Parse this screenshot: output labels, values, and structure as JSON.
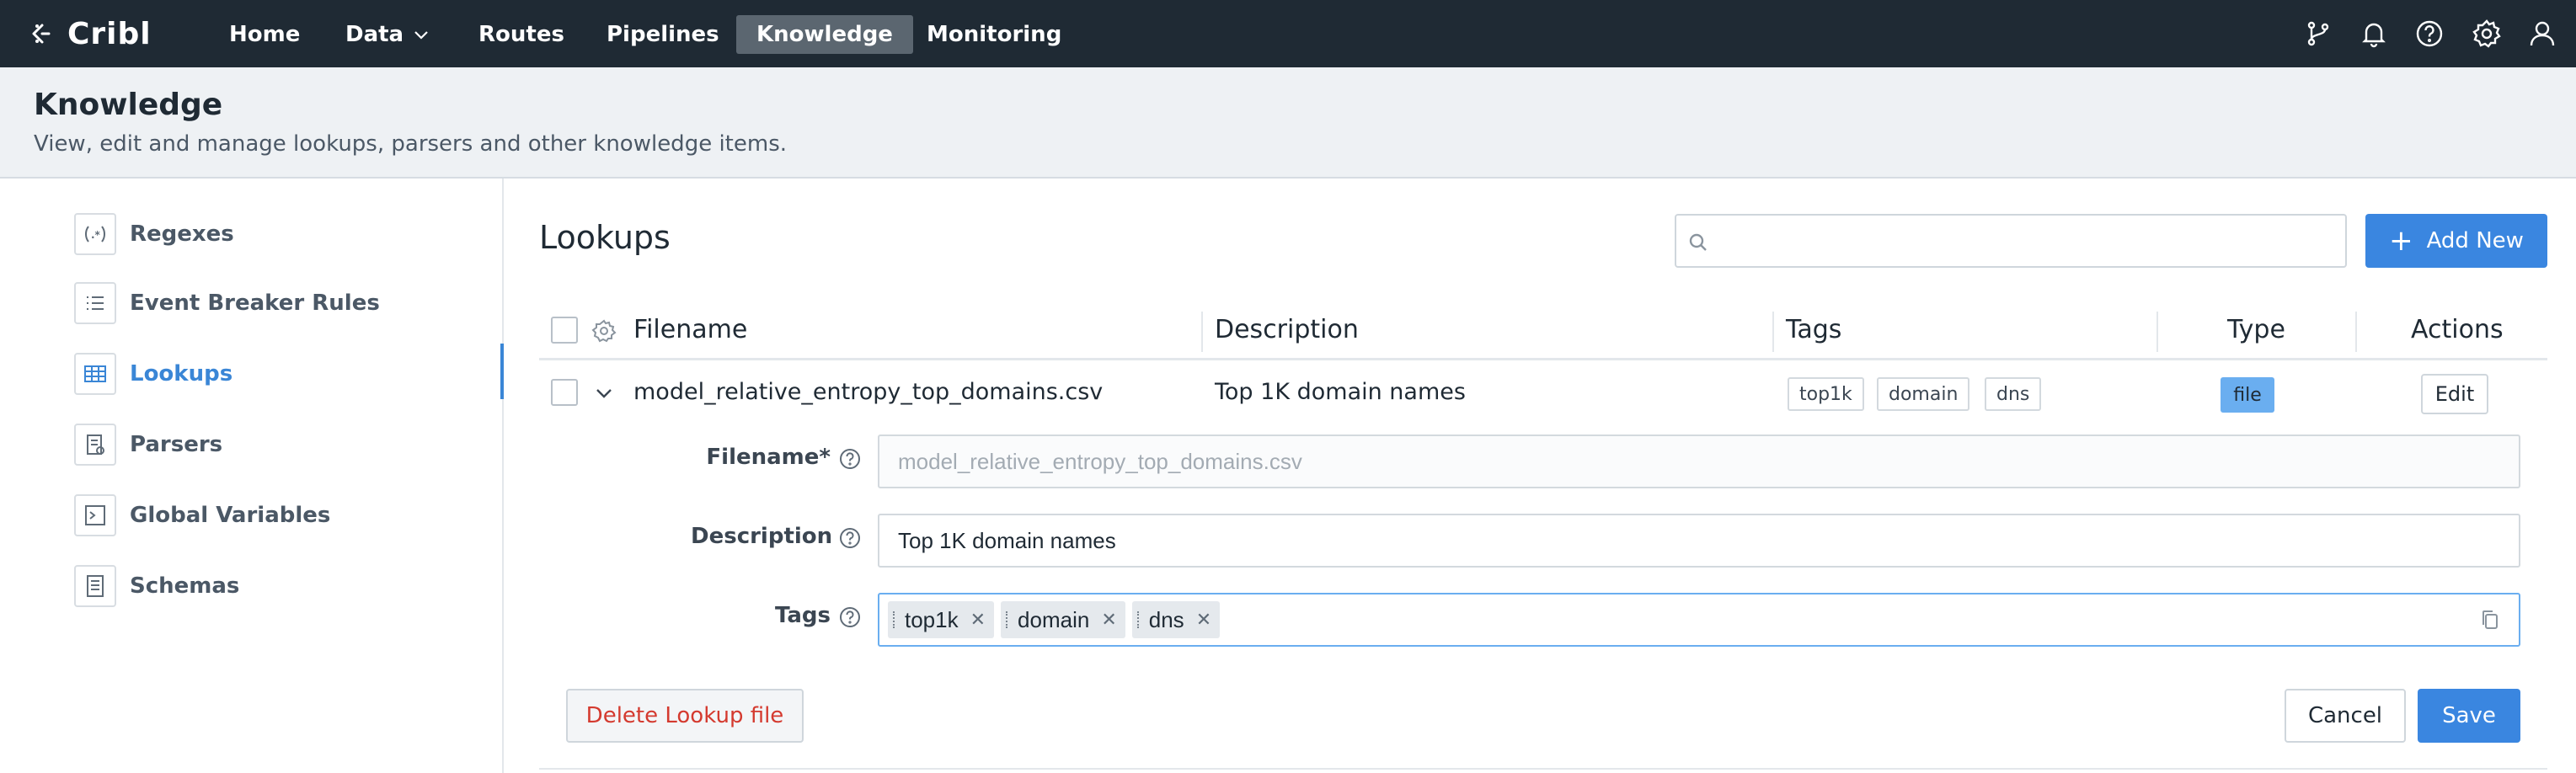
{
  "app": {
    "logo_text": "Cribl"
  },
  "nav": {
    "items": [
      {
        "label": "Home"
      },
      {
        "label": "Data"
      },
      {
        "label": "Routes"
      },
      {
        "label": "Pipelines"
      },
      {
        "label": "Knowledge"
      },
      {
        "label": "Monitoring"
      }
    ],
    "active": "Knowledge",
    "right_icons": [
      "git-branch-icon",
      "bell-icon",
      "help-icon",
      "gear-icon",
      "user-icon"
    ]
  },
  "header": {
    "title": "Knowledge",
    "subtitle": "View, edit and manage lookups, parsers and other knowledge items."
  },
  "sidebar": {
    "items": [
      {
        "label": "Regexes",
        "icon": "regex-icon"
      },
      {
        "label": "Event Breaker Rules",
        "icon": "list-icon"
      },
      {
        "label": "Lookups",
        "icon": "table-icon"
      },
      {
        "label": "Parsers",
        "icon": "parser-icon"
      },
      {
        "label": "Global Variables",
        "icon": "terminal-icon"
      },
      {
        "label": "Schemas",
        "icon": "schema-icon"
      }
    ],
    "active": "Lookups"
  },
  "main": {
    "title": "Lookups",
    "search_placeholder": "",
    "add_new_label": "Add New",
    "columns": [
      "Filename",
      "Description",
      "Tags",
      "Type",
      "Actions"
    ],
    "rows": [
      {
        "filename": "model_relative_entropy_top_domains.csv",
        "description": "Top 1K domain names",
        "tags": [
          "top1k",
          "domain",
          "dns"
        ],
        "type": "file",
        "action": "Edit"
      }
    ]
  },
  "form": {
    "filename_label": "Filename*",
    "filename_value": "model_relative_entropy_top_domains.csv",
    "description_label": "Description",
    "description_value": "Top 1K domain names",
    "tags_label": "Tags",
    "tags": [
      "top1k",
      "domain",
      "dns"
    ],
    "delete_label": "Delete Lookup file",
    "cancel_label": "Cancel",
    "save_label": "Save"
  },
  "colors": {
    "nav_bg": "#1f2a34",
    "accent": "#3a86e0",
    "delete_text": "#d43a2f",
    "type_badge": "#6aaef0"
  }
}
